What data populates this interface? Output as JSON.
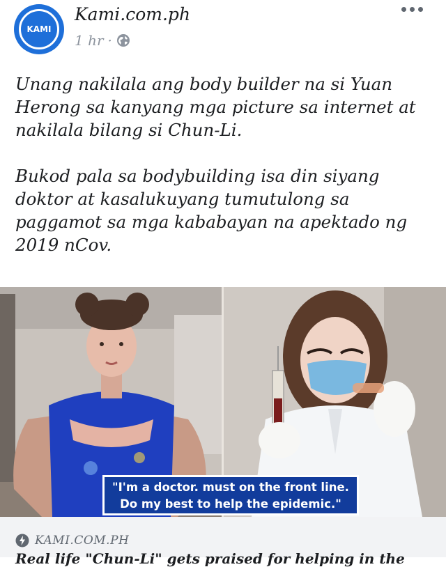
{
  "page": {
    "avatar_text": "KAMI",
    "name": "Kami.com.ph",
    "time": "1 hr",
    "separator": "·"
  },
  "post": {
    "paragraph_1": "Unang nakilala ang body builder na si Yuan Herong sa kanyang mga picture sa internet at nakilala bilang si Chun-Li.",
    "paragraph_2": "Bukod pala sa bodybuilding isa din siyang doktor at kasalukuyang tumutulong sa paggamot sa mga kababayan na apektado ng 2019 nCov."
  },
  "media": {
    "caption_line_1": "\"I'm a doctor. must on the front line.",
    "caption_line_2": "Do my best to help the epidemic.\""
  },
  "link": {
    "source": "KAMI.COM.PH",
    "title": "Real life \"Chun-Li\" gets praised for helping in the"
  },
  "icons": {
    "privacy": "globe-icon",
    "menu": "more-options-icon",
    "source": "lightning-bolt-icon"
  },
  "colors": {
    "brand_blue": "#1e6fd9",
    "caption_bg": "#123c9c",
    "footer_bg": "#f2f3f5"
  }
}
